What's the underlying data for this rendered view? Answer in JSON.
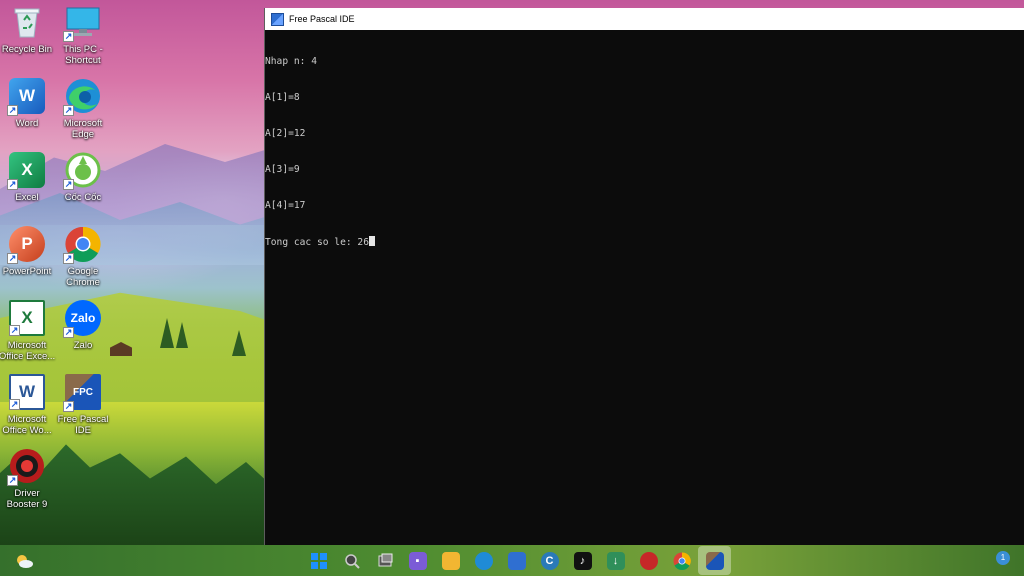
{
  "desktop": {
    "icons": [
      {
        "label": "Recycle Bin",
        "icon": "recycle-bin-icon",
        "shortcut": false
      },
      {
        "label": "This PC -\nShortcut",
        "icon": "monitor-icon",
        "shortcut": true
      },
      {
        "label": "Word",
        "icon": "word-icon",
        "glyph": "W",
        "color": "#1f5fbf",
        "shortcut": true
      },
      {
        "label": "Microsoft\nEdge",
        "icon": "edge-icon",
        "shortcut": true
      },
      {
        "label": "Excel",
        "icon": "excel-icon",
        "glyph": "X",
        "color": "#1d7b45",
        "shortcut": true
      },
      {
        "label": "Cốc Cốc",
        "icon": "coccoc-icon",
        "shortcut": true
      },
      {
        "label": "PowerPoint",
        "icon": "powerpoint-icon",
        "glyph": "P",
        "color": "#d04a2b",
        "shortcut": true
      },
      {
        "label": "Google\nChrome",
        "icon": "chrome-icon",
        "shortcut": true
      },
      {
        "label": "Microsoft\nOffice Exce...",
        "icon": "office-excel-icon",
        "glyph": "X",
        "color": "#1e7a3c",
        "shortcut": true
      },
      {
        "label": "Zalo",
        "icon": "zalo-icon",
        "glyph": "Zalo",
        "color": "#0068ff",
        "shortcut": true
      },
      {
        "label": "Microsoft\nOffice Wo...",
        "icon": "office-word-icon",
        "glyph": "W",
        "color": "#2b5797",
        "shortcut": true
      },
      {
        "label": "Free Pascal\nIDE",
        "icon": "free-pascal-icon",
        "glyph": "FPC",
        "color": "#1a55b8",
        "shortcut": true
      },
      {
        "label": "Driver\nBooster 9",
        "icon": "driver-booster-icon",
        "shortcut": true
      }
    ]
  },
  "window": {
    "title": "Free Pascal IDE",
    "console_lines": [
      "Nhap n: 4",
      "A[1]=8",
      "A[2]=12",
      "A[3]=9",
      "A[4]=17",
      "Tong cac so le: 26"
    ]
  },
  "taskbar": {
    "apps": [
      {
        "name": "start-icon",
        "color": "#1e90ff"
      },
      {
        "name": "search-icon",
        "color": "#555555"
      },
      {
        "name": "task-view-icon",
        "color": "#444444"
      },
      {
        "name": "chat-icon",
        "color": "#7b5cd6"
      },
      {
        "name": "file-explorer-icon",
        "color": "#f2b632"
      },
      {
        "name": "edge-icon",
        "color": "#1f8bd6"
      },
      {
        "name": "store-icon",
        "color": "#2f6fd1"
      },
      {
        "name": "coccoc-c-icon",
        "color": "#2a7ab8"
      },
      {
        "name": "tiktok-icon",
        "color": "#111111"
      },
      {
        "name": "download-icon",
        "color": "#2f8f5a"
      },
      {
        "name": "driver-booster-icon",
        "color": "#c62828"
      },
      {
        "name": "chrome-icon",
        "color": "#e0a800"
      },
      {
        "name": "free-pascal-icon",
        "color": "#1a55b8",
        "active": true
      }
    ],
    "notification_count": "1"
  }
}
